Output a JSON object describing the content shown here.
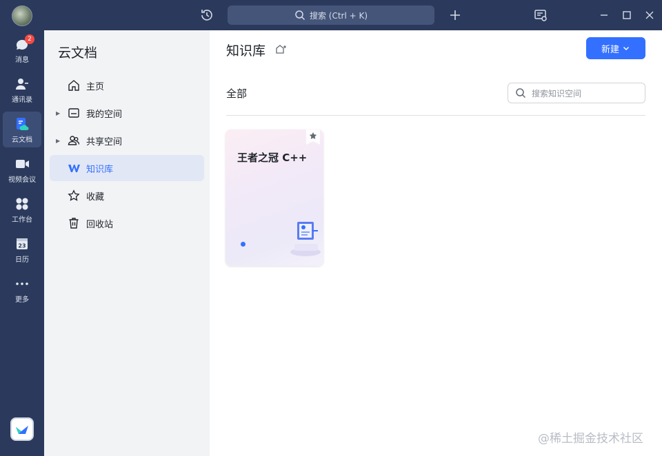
{
  "titlebar": {
    "search_placeholder": "搜索 (Ctrl + K)",
    "icons": [
      "history-icon",
      "add-icon",
      "notification-settings-icon",
      "minimize-icon",
      "maximize-icon",
      "close-icon"
    ]
  },
  "rail": {
    "items": [
      {
        "label": "消息",
        "icon": "message-icon",
        "badge": "2"
      },
      {
        "label": "通讯录",
        "icon": "contacts-icon"
      },
      {
        "label": "云文档",
        "icon": "cloud-doc-icon",
        "active": true
      },
      {
        "label": "视频会议",
        "icon": "video-meeting-icon"
      },
      {
        "label": "工作台",
        "icon": "workspace-icon"
      },
      {
        "label": "日历",
        "icon": "calendar-icon",
        "calendar_day": "23"
      },
      {
        "label": "更多",
        "icon": "more-icon"
      }
    ]
  },
  "sidebar": {
    "title": "云文档",
    "items": [
      {
        "label": "主页",
        "icon": "home-icon"
      },
      {
        "label": "我的空间",
        "icon": "folder-icon",
        "expandable": true
      },
      {
        "label": "共享空间",
        "icon": "shared-users-icon",
        "expandable": true
      },
      {
        "label": "知识库",
        "icon": "wiki-icon",
        "active": true
      },
      {
        "label": "收藏",
        "icon": "star-icon"
      },
      {
        "label": "回收站",
        "icon": "trash-icon"
      }
    ]
  },
  "main": {
    "title": "知识库",
    "new_button": "新建",
    "filter_label": "全部",
    "search_placeholder": "搜索知识空间",
    "cards": [
      {
        "title": "王者之冠 C++"
      }
    ]
  },
  "watermark": "@稀土掘金技术社区",
  "colors": {
    "accent": "#3370ff",
    "rail_bg": "#2b3a5c",
    "sidebar_bg": "#f2f3f5",
    "badge": "#f54a45"
  }
}
